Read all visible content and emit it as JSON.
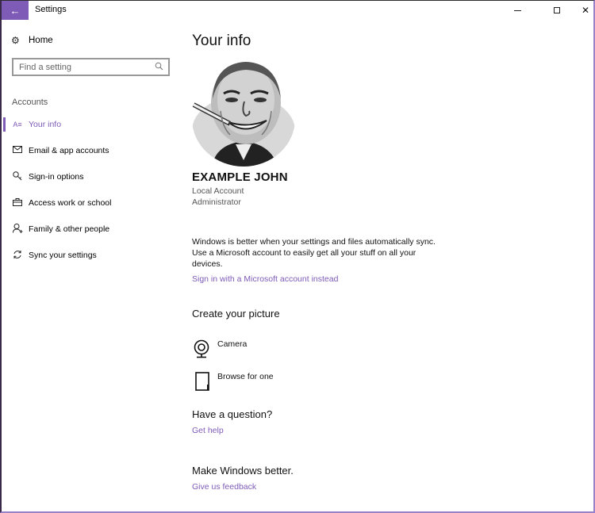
{
  "window": {
    "title": "Settings",
    "back_icon": "back-arrow-icon",
    "controls": {
      "minimize": "minimize-icon",
      "maximize": "maximize-icon",
      "close": "close-icon"
    },
    "back_glyph": "←",
    "close_glyph": "✕"
  },
  "colors": {
    "accent": "#7e5bb7",
    "text": "#111111",
    "muted": "#555555"
  },
  "sidebar": {
    "home": {
      "label": "Home",
      "icon": "gear-icon",
      "glyph": "⚙"
    },
    "search": {
      "placeholder": "Find a setting",
      "icon": "search-icon",
      "glyph": "⌕"
    },
    "section_label": "Accounts",
    "items": [
      {
        "label": "Your info",
        "icon": "person-card-icon",
        "glyph": "A≡",
        "active": true
      },
      {
        "label": "Email & app accounts",
        "icon": "mail-icon",
        "glyph": "✉",
        "active": false
      },
      {
        "label": "Sign-in options",
        "icon": "key-icon",
        "glyph": "⚲",
        "active": false
      },
      {
        "label": "Access work or school",
        "icon": "briefcase-icon",
        "glyph": "✉",
        "active": false
      },
      {
        "label": "Family & other people",
        "icon": "add-person-icon",
        "glyph": "♀",
        "active": false
      },
      {
        "label": "Sync your settings",
        "icon": "sync-icon",
        "glyph": "↻",
        "active": false
      }
    ]
  },
  "main": {
    "title": "Your info",
    "profile": {
      "avatar": "profile-picture",
      "name": "EXAMPLE JOHN",
      "account_type": "Local Account",
      "role": "Administrator"
    },
    "sync_text": "Windows is better when your settings and files automatically sync. Use a Microsoft account to easily get all your stuff on all your devices.",
    "signin_link": "Sign in with a Microsoft account instead",
    "create_picture": {
      "heading": "Create your picture",
      "options": [
        {
          "label": "Camera",
          "icon": "camera-icon"
        },
        {
          "label": "Browse for one",
          "icon": "browse-icon"
        }
      ]
    },
    "question": {
      "heading": "Have a question?",
      "link": "Get help"
    },
    "better": {
      "heading": "Make Windows better.",
      "link": "Give us feedback"
    }
  }
}
